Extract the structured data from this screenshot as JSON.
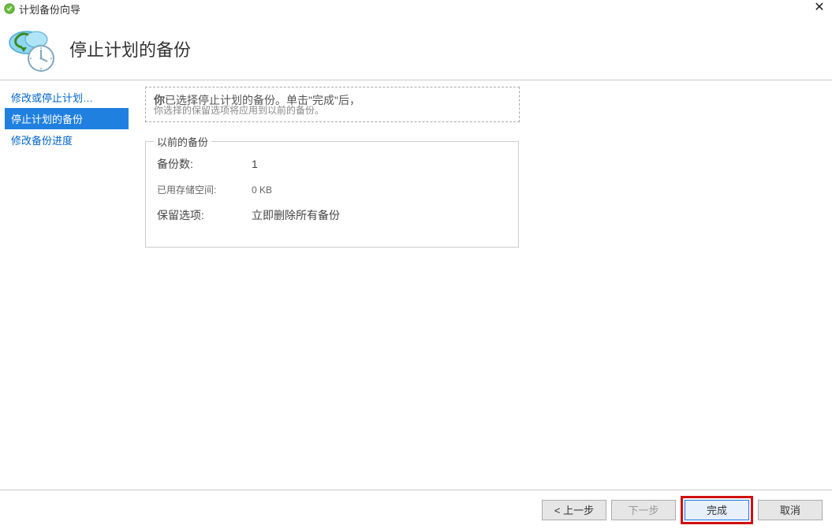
{
  "window": {
    "title": "计划备份向导"
  },
  "header": {
    "title": "停止计划的备份"
  },
  "sidebar": {
    "items": [
      {
        "label": "修改或停止计划…",
        "active": false
      },
      {
        "label": "停止计划的备份",
        "active": true
      },
      {
        "label": "修改备份进度",
        "active": false
      }
    ]
  },
  "content": {
    "instruction_line1_a": "你",
    "instruction_line1_b": "已选择停止计划的备份",
    "instruction_line1_c": "。单击\"完成\"后，",
    "instruction_line2": "你选择的保留选项将应用到以前的备份。",
    "group_title": "以前的备份",
    "rows": {
      "backup_count_label": "备份数:",
      "backup_count_value": "1",
      "used_space_label": "已用存储空间:",
      "used_space_value": "0 KB",
      "retention_label": "保留选项:",
      "retention_value": "立即删除所有备份"
    }
  },
  "footer": {
    "prev": "< 上一步",
    "next": "下一步",
    "finish": "完成",
    "cancel": "取消"
  }
}
